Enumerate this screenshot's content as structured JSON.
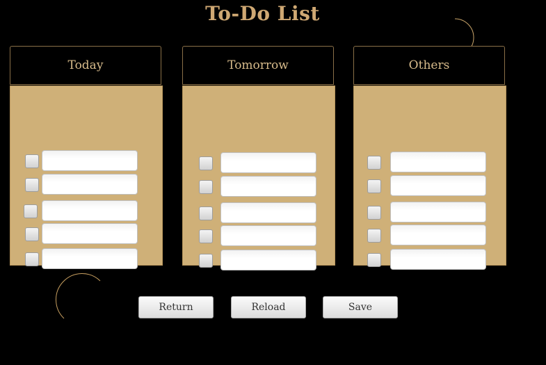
{
  "app": {
    "title": "To-Do List"
  },
  "colors": {
    "background": "#000000",
    "accent": "#cfa873",
    "panel": "#cfb078",
    "moon": "#f3dfb8"
  },
  "columns": [
    {
      "header": "Today",
      "tasks": [
        {
          "value": "",
          "checked": false
        },
        {
          "value": "",
          "checked": false
        },
        {
          "value": "",
          "checked": false
        },
        {
          "value": "",
          "checked": false
        },
        {
          "value": "",
          "checked": false
        }
      ]
    },
    {
      "header": "Tomorrow",
      "tasks": [
        {
          "value": "",
          "checked": false
        },
        {
          "value": "",
          "checked": false
        },
        {
          "value": "",
          "checked": false
        },
        {
          "value": "",
          "checked": false
        },
        {
          "value": "",
          "checked": false
        }
      ]
    },
    {
      "header": "Others",
      "tasks": [
        {
          "value": "",
          "checked": false
        },
        {
          "value": "",
          "checked": false
        },
        {
          "value": "",
          "checked": false
        },
        {
          "value": "",
          "checked": false
        },
        {
          "value": "",
          "checked": false
        }
      ]
    }
  ],
  "buttons": {
    "return_label": "Return",
    "reload_label": "Reload",
    "save_label": "Save"
  },
  "decorations": {
    "top_icon": "crescent-moon-icon",
    "bottom_icon": "crescent-moon-icon"
  }
}
